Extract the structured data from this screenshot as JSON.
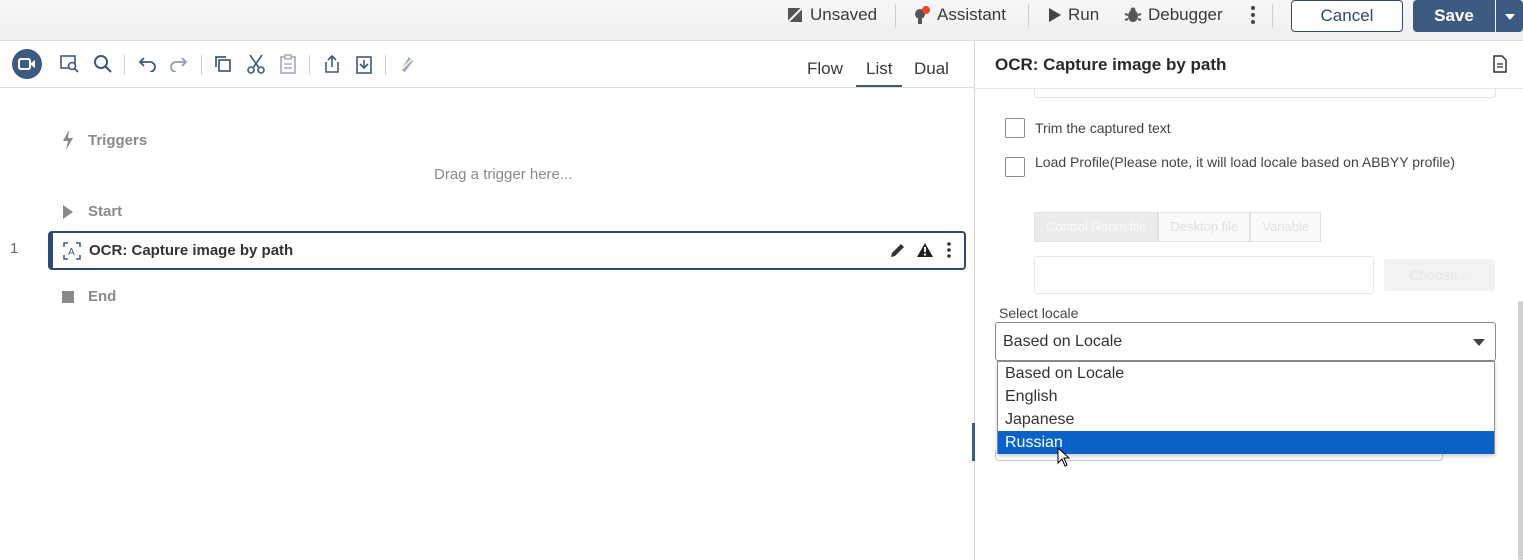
{
  "topbar": {
    "unsaved_label": "Unsaved",
    "assistant_label": "Assistant",
    "run_label": "Run",
    "debugger_label": "Debugger",
    "cancel_label": "Cancel",
    "save_label": "Save"
  },
  "view_tabs": {
    "flow": "Flow",
    "list": "List",
    "dual": "Dual",
    "active": "List"
  },
  "flow": {
    "triggers_label": "Triggers",
    "drag_hint": "Drag a trigger here...",
    "start_label": "Start",
    "end_label": "End",
    "actions": [
      {
        "line": "1",
        "label": "OCR: Capture image by path"
      }
    ]
  },
  "panel": {
    "title": "OCR: Capture image by path",
    "trim_label": "Trim the captured text",
    "load_profile_label": "Load Profile(Please note, it will load locale based on ABBYY profile)",
    "source_tabs": [
      "Control Room file",
      "Desktop file",
      "Variable"
    ],
    "choose_label": "Choose...",
    "locale_label": "Select locale",
    "locale_value": "Based on Locale",
    "locale_options": [
      "Based on Locale",
      "English",
      "Japanese",
      "Russian"
    ],
    "highlighted_option": "Russian"
  },
  "colors": {
    "accent": "#3d5a80",
    "selection": "#0a62c9",
    "badge": "#e8472b"
  }
}
